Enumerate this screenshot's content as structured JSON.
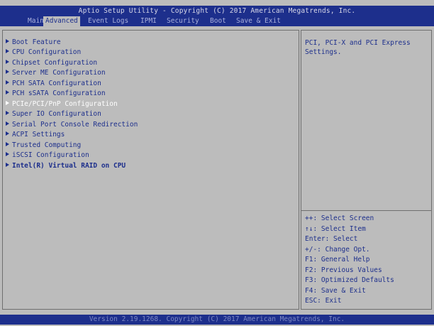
{
  "title": "Aptio Setup Utility - Copyright (C) 2017 American Megatrends, Inc.",
  "tabs": [
    {
      "label": "Main"
    },
    {
      "label": "Advanced"
    },
    {
      "label": "Event Logs"
    },
    {
      "label": "IPMI"
    },
    {
      "label": "Security"
    },
    {
      "label": "Boot"
    },
    {
      "label": "Save & Exit"
    }
  ],
  "active_tab": "Advanced",
  "menu": {
    "items": [
      {
        "label": "Boot Feature"
      },
      {
        "label": "CPU Configuration"
      },
      {
        "label": "Chipset Configuration"
      },
      {
        "label": "Server ME Configuration"
      },
      {
        "label": "PCH SATA Configuration"
      },
      {
        "label": "PCH sSATA Configuration"
      },
      {
        "label": "PCIe/PCI/PnP Configuration"
      },
      {
        "label": "Super IO Configuration"
      },
      {
        "label": "Serial Port Console Redirection"
      },
      {
        "label": "ACPI Settings"
      },
      {
        "label": "Trusted Computing"
      },
      {
        "label": "iSCSI Configuration"
      },
      {
        "label": "Intel(R) Virtual RAID on CPU"
      }
    ],
    "selected_label": "PCIe/PCI/PnP Configuration"
  },
  "help": {
    "description": "PCI, PCI-X and PCI Express Settings.",
    "keys": [
      {
        "text": "++: Select Screen"
      },
      {
        "text": "↑↓: Select Item"
      },
      {
        "text": "Enter: Select"
      },
      {
        "text": "+/-: Change Opt."
      },
      {
        "text": "F1: General Help"
      },
      {
        "text": "F2: Previous Values"
      },
      {
        "text": "F3: Optimized Defaults"
      },
      {
        "text": "F4: Save & Exit"
      },
      {
        "text": "ESC: Exit"
      }
    ]
  },
  "footer": "Version 2.19.1268. Copyright (C) 2017 American Megatrends, Inc.",
  "colors": {
    "header_blue": "#1d2f8c",
    "panel_gray": "#bcbcbc",
    "selected_text": "#ffffff"
  }
}
